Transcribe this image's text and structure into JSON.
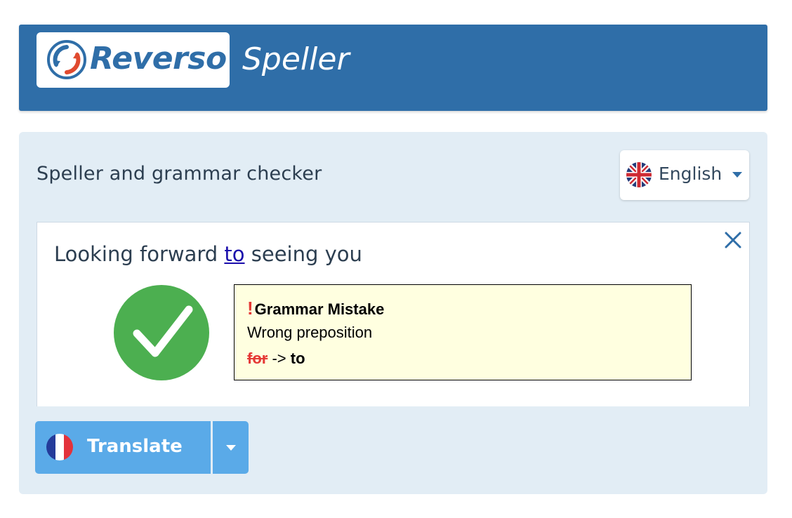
{
  "header": {
    "logo_text": "Reverso",
    "app_name": "Speller",
    "brand_color": "#2f6ea8"
  },
  "checker": {
    "title": "Speller and grammar checker",
    "language": {
      "label": "English",
      "flag_icon": "uk-flag-icon"
    },
    "editor": {
      "text_before": "Looking forward ",
      "corrected_word": "to",
      "text_after": " seeing you",
      "close_icon": "close-icon"
    },
    "result_icon": "checkmark-circle-icon",
    "tooltip": {
      "title_marker": "!",
      "title": "Grammar Mistake",
      "description": "Wrong preposition",
      "wrong_word": "for",
      "arrow": "->",
      "suggestion": "to"
    }
  },
  "actions": {
    "translate_label": "Translate",
    "translate_flag_icon": "france-flag-icon",
    "dropdown_icon": "chevron-down-icon",
    "button_color": "#5aaae8"
  },
  "colors": {
    "error": "#e53935",
    "success": "#4caf50",
    "tooltip_bg": "#ffffe0",
    "panel_bg": "#e2edf5"
  }
}
